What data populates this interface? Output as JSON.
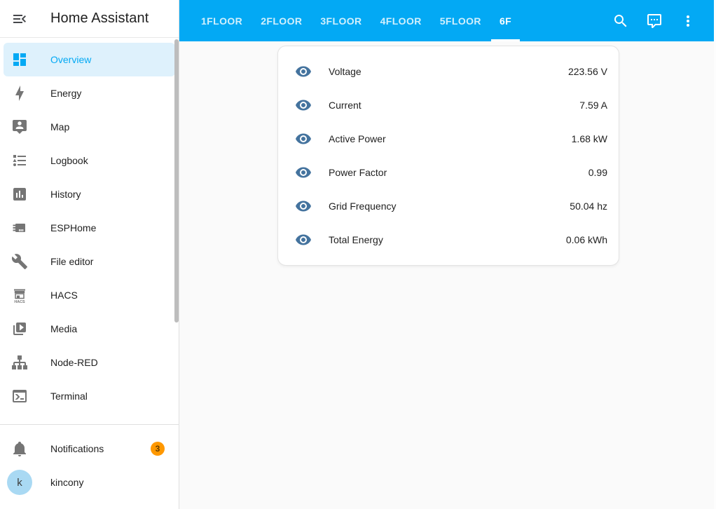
{
  "colors": {
    "header_bg": "#03a9f4",
    "primary_accent": "#03a9f4",
    "notification_badge": "#ff9800",
    "entity_icon": "#44739e",
    "selected_item_bg": "#def1fc"
  },
  "sidebar": {
    "title": "Home Assistant",
    "menu_icon": "menu-open-icon",
    "items": [
      {
        "label": "Overview",
        "icon": "view-dashboard-icon",
        "selected": true
      },
      {
        "label": "Energy",
        "icon": "lightning-bolt-icon",
        "selected": false
      },
      {
        "label": "Map",
        "icon": "tooltip-account-icon",
        "selected": false
      },
      {
        "label": "Logbook",
        "icon": "format-list-bulleted-icon",
        "selected": false
      },
      {
        "label": "History",
        "icon": "chart-box-icon",
        "selected": false
      },
      {
        "label": "ESPHome",
        "icon": "chip-icon",
        "selected": false
      },
      {
        "label": "File editor",
        "icon": "wrench-icon",
        "selected": false
      },
      {
        "label": "HACS",
        "icon": "hacs-store-icon",
        "selected": false
      },
      {
        "label": "Media",
        "icon": "play-box-multiple-icon",
        "selected": false
      },
      {
        "label": "Node-RED",
        "icon": "sitemap-icon",
        "selected": false
      },
      {
        "label": "Terminal",
        "icon": "console-icon",
        "selected": false
      }
    ],
    "notifications": {
      "label": "Notifications",
      "icon": "bell-icon",
      "badge": "3"
    },
    "user": {
      "name": "kincony",
      "avatar_letter": "k"
    }
  },
  "topbar": {
    "tabs": [
      {
        "label": "1FLOOR",
        "active": false
      },
      {
        "label": "2FLOOR",
        "active": false
      },
      {
        "label": "3FLOOR",
        "active": false
      },
      {
        "label": "4FLOOR",
        "active": false
      },
      {
        "label": "5FLOOR",
        "active": false
      },
      {
        "label": "6F",
        "active": true
      }
    ],
    "icons": [
      "search-icon",
      "assist-chat-icon",
      "more-vertical-icon"
    ]
  },
  "card": {
    "rows": [
      {
        "icon": "eye-icon",
        "name": "Voltage",
        "value": "223.56 V"
      },
      {
        "icon": "eye-icon",
        "name": "Current",
        "value": "7.59 A"
      },
      {
        "icon": "eye-icon",
        "name": "Active Power",
        "value": "1.68 kW"
      },
      {
        "icon": "eye-icon",
        "name": "Power Factor",
        "value": "0.99"
      },
      {
        "icon": "eye-icon",
        "name": "Grid Frequency",
        "value": "50.04 hz"
      },
      {
        "icon": "eye-icon",
        "name": "Total Energy",
        "value": "0.06 kWh"
      }
    ]
  }
}
